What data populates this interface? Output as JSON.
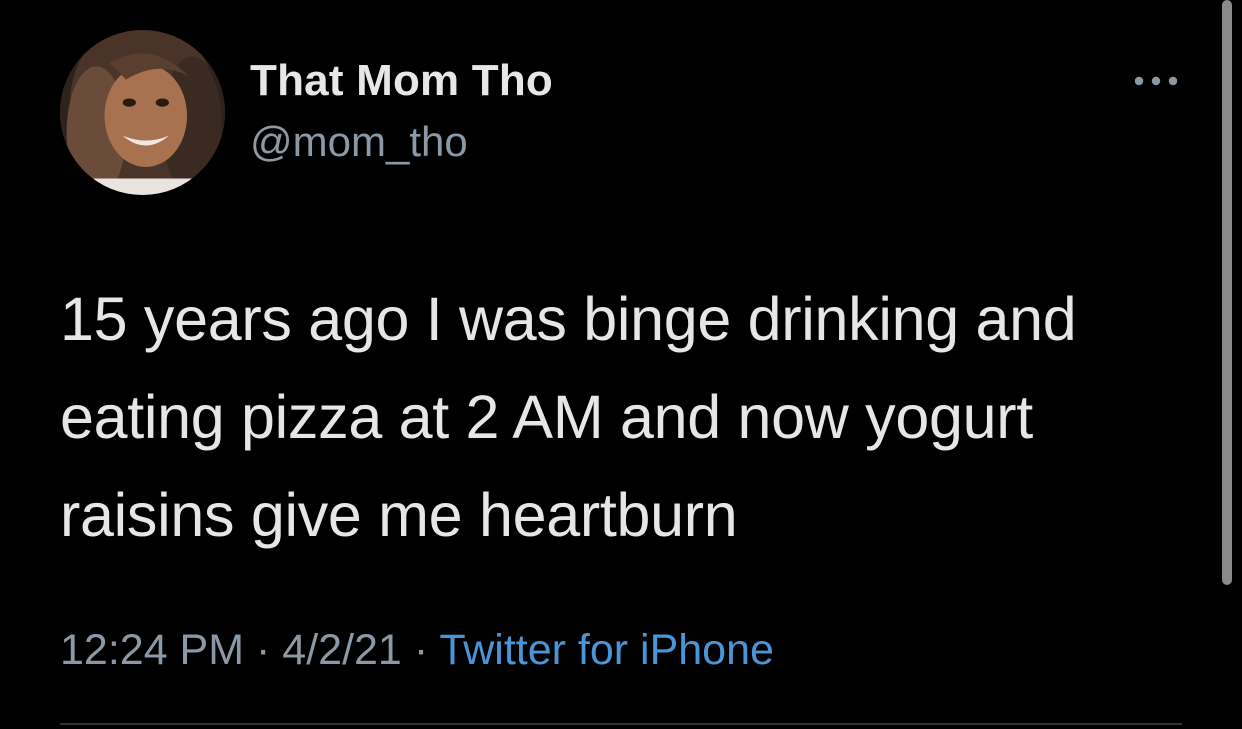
{
  "tweet": {
    "display_name": "That Mom Tho",
    "handle": "@mom_tho",
    "text": "15 years ago I was binge drinking and eating pizza at 2 AM and now yogurt raisins give me heartburn",
    "time": "12:24 PM",
    "date": "4/2/21",
    "separator": "·",
    "source": "Twitter for iPhone"
  },
  "icons": {
    "more": "more-horizontal-icon",
    "avatar": "user-avatar-photo"
  },
  "colors": {
    "background": "#000000",
    "primary_text": "#e6e6e6",
    "secondary_text": "#8b98a5",
    "link": "#4a95d8"
  }
}
